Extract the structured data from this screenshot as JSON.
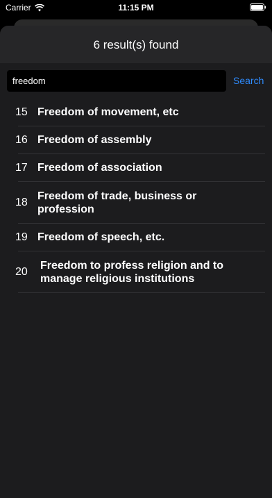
{
  "status_bar": {
    "carrier": "Carrier",
    "time": "11:15 PM"
  },
  "header": {
    "title": "6 result(s) found"
  },
  "search": {
    "value": "freedom",
    "button_label": "Search"
  },
  "results": [
    {
      "number": "15",
      "title": "Freedom of movement, etc"
    },
    {
      "number": "16",
      "title": "Freedom of assembly"
    },
    {
      "number": "17",
      "title": "Freedom of association"
    },
    {
      "number": "18",
      "title": "Freedom of trade, business or profession"
    },
    {
      "number": "19",
      "title": "Freedom of speech, etc."
    },
    {
      "number": "20",
      "title": "Freedom to profess religion and to manage religious institutions"
    }
  ],
  "colors": {
    "accent": "#2f8cff",
    "background": "#1c1c1e"
  }
}
